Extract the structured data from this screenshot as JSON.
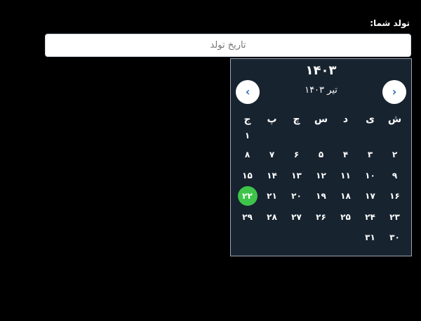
{
  "form": {
    "birth_label": "تولد شما:",
    "birth_placeholder": "تاریخ تولد"
  },
  "calendar": {
    "year": "۱۴۰۳",
    "month_title": "تیر ۱۴۰۳",
    "next_label": "‹",
    "prev_label": "›",
    "weekdays": [
      "ش",
      "ی",
      "د",
      "س",
      "چ",
      "پ",
      "ج"
    ],
    "weeks": [
      [
        "",
        "",
        "",
        "",
        "",
        "",
        "۱"
      ],
      [
        "۲",
        "۳",
        "۴",
        "۵",
        "۶",
        "۷",
        "۸"
      ],
      [
        "۹",
        "۱۰",
        "۱۱",
        "۱۲",
        "۱۳",
        "۱۴",
        "۱۵"
      ],
      [
        "۱۶",
        "۱۷",
        "۱۸",
        "۱۹",
        "۲۰",
        "۲۱",
        "۲۲"
      ],
      [
        "۲۳",
        "۲۴",
        "۲۵",
        "۲۶",
        "۲۷",
        "۲۸",
        "۲۹"
      ],
      [
        "۳۰",
        "۳۱",
        "",
        "",
        "",
        "",
        ""
      ]
    ],
    "selected_day": "۲۲",
    "selected_color": "#3ec44a",
    "background_color": "#17232f"
  }
}
